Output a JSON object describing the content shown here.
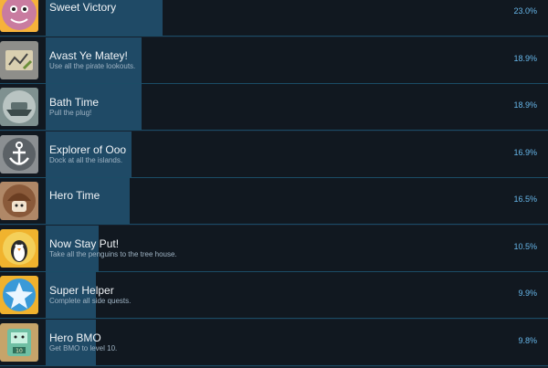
{
  "achievements": [
    {
      "title": "Sweet Victory",
      "description": "",
      "percent_label": "23.0%",
      "percent": 23.0,
      "icon": "cupcake-icon",
      "bg": "#f6b23a"
    },
    {
      "title": "Avast Ye Matey!",
      "description": "Use all the pirate lookouts.",
      "percent_label": "18.9%",
      "percent": 18.9,
      "icon": "treasure-map-icon",
      "bg": "#8e8e8a"
    },
    {
      "title": "Bath Time",
      "description": "Pull the plug!",
      "percent_label": "18.9%",
      "percent": 18.9,
      "icon": "ship-icon",
      "bg": "#7f9190"
    },
    {
      "title": "Explorer of Ooo",
      "description": "Dock at all the islands.",
      "percent_label": "16.9%",
      "percent": 16.9,
      "icon": "anchor-icon",
      "bg": "#8b8f92"
    },
    {
      "title": "Hero Time",
      "description": "",
      "percent_label": "16.5%",
      "percent": 16.5,
      "icon": "hero-face-icon",
      "bg": "#b08867"
    },
    {
      "title": "Now Stay Put!",
      "description": "Take all the penguins to the tree house.",
      "percent_label": "10.5%",
      "percent": 10.5,
      "icon": "penguin-icon",
      "bg": "#f0b32e"
    },
    {
      "title": "Super Helper",
      "description": "Complete all side quests.",
      "percent_label": "9.9%",
      "percent": 9.9,
      "icon": "star-icon",
      "bg": "#f0b22e"
    },
    {
      "title": "Hero BMO",
      "description": "Get BMO to level 10.",
      "percent_label": "9.8%",
      "percent": 9.8,
      "icon": "bmo-icon",
      "bg": "#c6a46a"
    }
  ]
}
